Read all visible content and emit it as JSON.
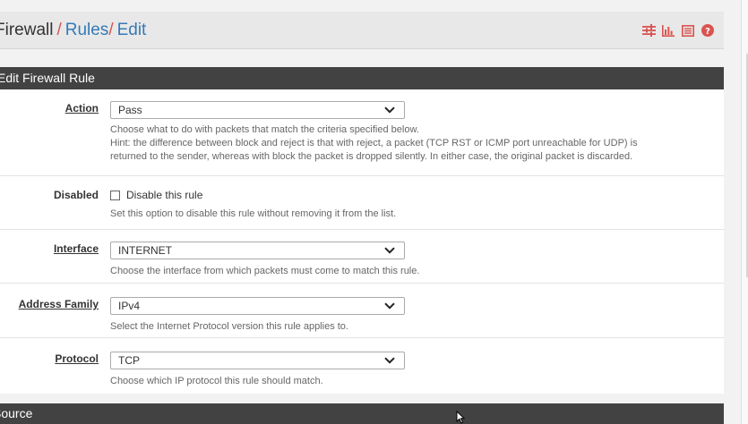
{
  "breadcrumb": {
    "root": "Firewall",
    "separator": "/",
    "rules": "Rules",
    "edit": "Edit"
  },
  "toolbar_icons": [
    "sliders-icon",
    "bar-chart-icon",
    "list-icon",
    "help-icon"
  ],
  "colors": {
    "accent_red": "#d9534f",
    "link_blue": "#337ab7",
    "panel_heading": "#424242"
  },
  "panel": {
    "heading": "Edit Firewall Rule"
  },
  "action": {
    "label": "Action",
    "value": "Pass",
    "help_1": "Choose what to do with packets that match the criteria specified below.",
    "help_2": "Hint: the difference between block and reject is that with reject, a packet (TCP RST or ICMP port unreachable for UDP) is",
    "help_3": "returned to the sender, whereas with block the packet is dropped silently. In either case, the original packet is discarded."
  },
  "disabled": {
    "label": "Disabled",
    "checkbox_label": "Disable this rule",
    "checked": false,
    "help": "Set this option to disable this rule without removing it from the list."
  },
  "interface": {
    "label": "Interface",
    "value": "INTERNET",
    "help": "Choose the interface from which packets must come to match this rule."
  },
  "address_family": {
    "label": "Address Family",
    "value": "IPv4",
    "help": "Select the Internet Protocol version this rule applies to."
  },
  "protocol": {
    "label": "Protocol",
    "value": "TCP",
    "help": "Choose which IP protocol this rule should match."
  },
  "source": {
    "heading": "Source"
  }
}
